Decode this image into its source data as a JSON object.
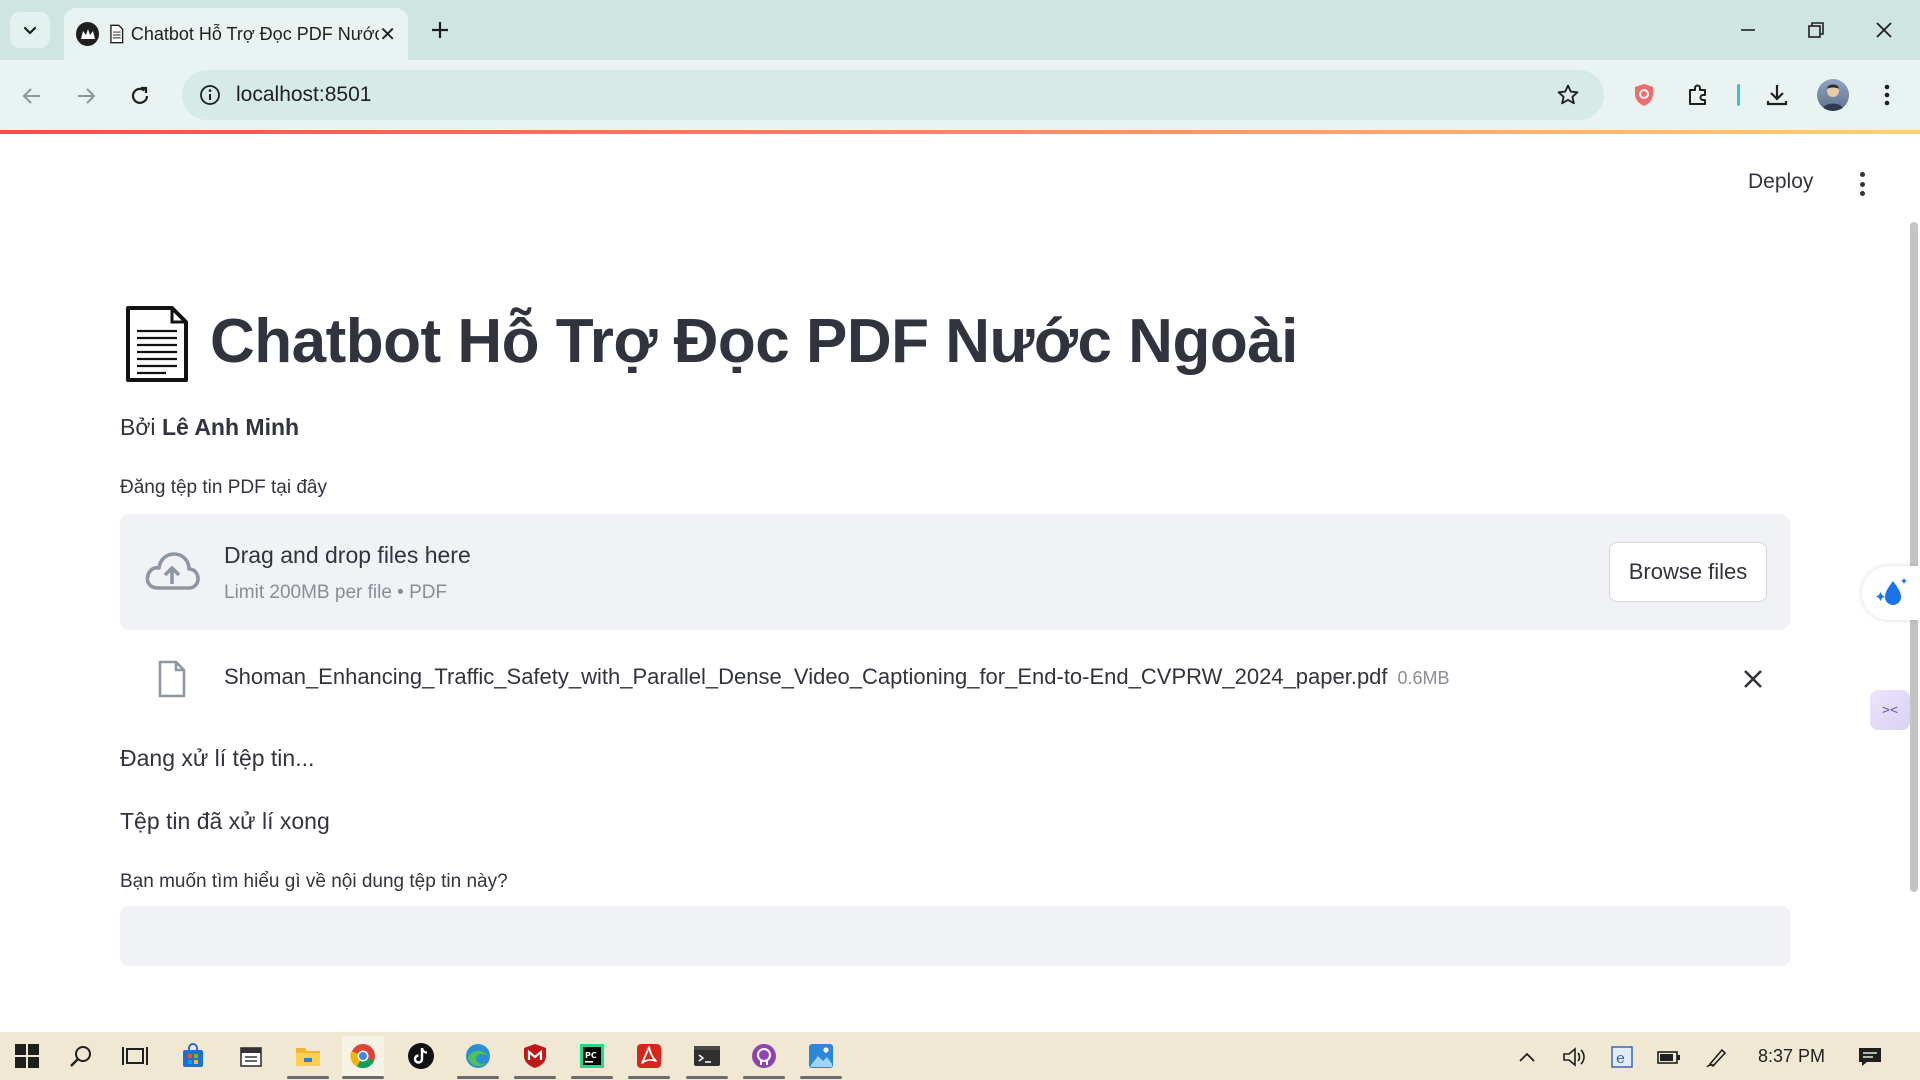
{
  "browser": {
    "tab_title": "Chatbot Hỗ Trợ Đọc PDF Nước Ngoài",
    "url": "localhost:8501"
  },
  "app": {
    "deploy_label": "Deploy",
    "title_icon": "page-facing-up-icon",
    "title": "Chatbot Hỗ Trợ Đọc PDF Nước Ngoài",
    "byline_prefix": "Bởi",
    "byline_author": "Lê Anh Minh",
    "upload_label": "Đăng tệp tin PDF tại đây",
    "dropzone_title": "Drag and drop files here",
    "dropzone_limit": "Limit 200MB per file • PDF",
    "browse_label": "Browse files",
    "uploaded_file": {
      "name": "Shoman_Enhancing_Traffic_Safety_with_Parallel_Dense_Video_Captioning_for_End-to-End_CVPRW_2024_paper.pdf",
      "size": "0.6MB"
    },
    "status_processing": "Đang xử lí tệp tin...",
    "status_done": "Tệp tin đã xử lí xong",
    "question_label": "Bạn muốn tìm hiểu gì về nội dung tệp tin này?",
    "question_value": ""
  },
  "taskbar": {
    "apps": [
      "start-icon",
      "search-icon",
      "task-view-icon",
      "store-icon",
      "calendar-icon",
      "file-explorer-icon",
      "chrome-icon",
      "tiktok-icon",
      "edge-icon",
      "mcafee-icon",
      "pycharm-icon",
      "acrobat-icon",
      "terminal-icon",
      "github-desktop-icon",
      "photos-icon"
    ],
    "clock": "8:37 PM"
  },
  "colors": {
    "tabstrip": "#cfe5e1",
    "toolbar": "#e9f4f2",
    "streamlit_accent": "#ff4b4b",
    "dropzone_bg": "#f0f2f6",
    "text": "#31333f",
    "taskbar": "#f0e8d2"
  }
}
